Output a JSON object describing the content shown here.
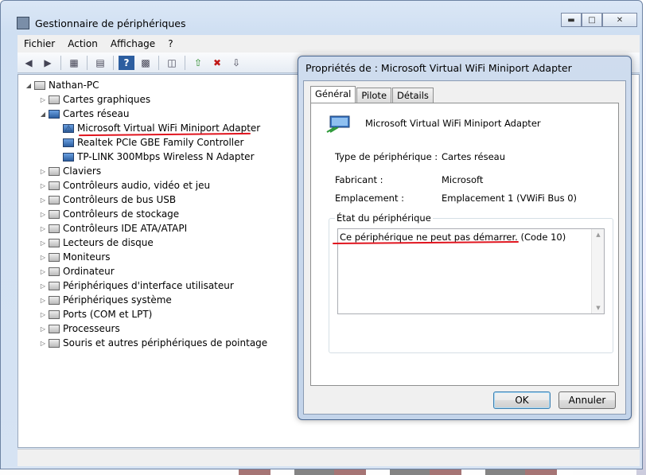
{
  "window": {
    "title": "Gestionnaire de périphériques",
    "caption_buttons": [
      "minimize",
      "maximize",
      "close"
    ]
  },
  "menu": [
    "Fichier",
    "Action",
    "Affichage",
    "?"
  ],
  "toolbar_icons": [
    "back-arrow-icon",
    "forward-arrow-icon",
    "show-hide-tree-icon",
    "properties-icon",
    "help-icon",
    "view-icon",
    "scan-hardware-icon",
    "update-driver-icon",
    "uninstall-icon",
    "disable-icon"
  ],
  "tree": {
    "root": "Nathan-PC",
    "categories": [
      {
        "label": "Cartes graphiques",
        "expanded": false
      },
      {
        "label": "Cartes réseau",
        "expanded": true,
        "children": [
          {
            "label": "Microsoft Virtual WiFi Miniport Adapter",
            "warning": true
          },
          {
            "label": "Realtek PCIe GBE Family Controller"
          },
          {
            "label": "TP-LINK 300Mbps Wireless N Adapter"
          }
        ]
      },
      {
        "label": "Claviers",
        "expanded": false
      },
      {
        "label": "Contrôleurs audio, vidéo et jeu",
        "expanded": false
      },
      {
        "label": "Contrôleurs de bus USB",
        "expanded": false
      },
      {
        "label": "Contrôleurs de stockage",
        "expanded": false
      },
      {
        "label": "Contrôleurs IDE ATA/ATAPI",
        "expanded": false
      },
      {
        "label": "Lecteurs de disque",
        "expanded": false
      },
      {
        "label": "Moniteurs",
        "expanded": false
      },
      {
        "label": "Ordinateur",
        "expanded": false
      },
      {
        "label": "Périphériques d'interface utilisateur",
        "expanded": false
      },
      {
        "label": "Périphériques système",
        "expanded": false
      },
      {
        "label": "Ports (COM et LPT)",
        "expanded": false
      },
      {
        "label": "Processeurs",
        "expanded": false
      },
      {
        "label": "Souris et autres périphériques de pointage",
        "expanded": false
      }
    ]
  },
  "dialog": {
    "title": "Propriétés de : Microsoft Virtual WiFi Miniport Adapter",
    "tabs": [
      "Général",
      "Pilote",
      "Détails"
    ],
    "active_tab": "Général",
    "device_name": "Microsoft Virtual WiFi Miniport Adapter",
    "fields": [
      {
        "label": "Type de périphérique :",
        "value": "Cartes réseau"
      },
      {
        "label": "Fabricant :",
        "value": "Microsoft"
      },
      {
        "label": "Emplacement :",
        "value": "Emplacement 1 (VWiFi Bus 0)"
      }
    ],
    "status_group_label": "État du périphérique",
    "status_text": "Ce périphérique ne peut pas démarrer. (Code 10)",
    "ok_label": "OK",
    "cancel_label": "Annuler"
  },
  "colors": {
    "annotation_red": "#e0141e",
    "titlebar": "#cfdff2"
  }
}
